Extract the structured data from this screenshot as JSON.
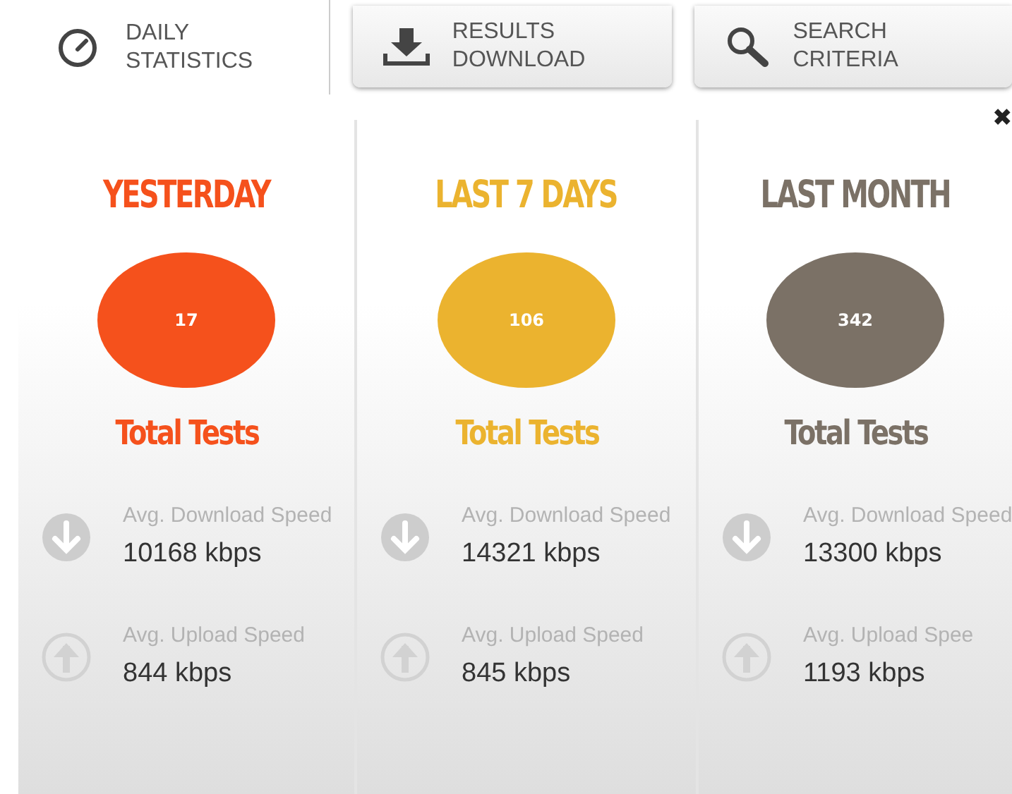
{
  "tabs": [
    {
      "kind": "gauge",
      "label_lines": [
        "DAILY",
        "STATISTICS"
      ],
      "selected": true
    },
    {
      "kind": "download",
      "label_lines": [
        "RESULTS",
        "DOWNLOAD"
      ],
      "selected": false
    },
    {
      "kind": "search",
      "label_lines": [
        "SEARCH",
        "CRITERIA"
      ],
      "selected": false
    }
  ],
  "close": "✖",
  "periods": [
    {
      "title": "YESTERDAY",
      "color": "#f5511c",
      "total": "17",
      "total_label": "Total Tests",
      "download_label": "Avg. Download Speed",
      "download": "10168 kbps",
      "upload_label": "Avg. Upload Speed",
      "upload": "844 kbps"
    },
    {
      "title": "LAST 7 DAYS",
      "color": "#ebb32f",
      "total": "106",
      "total_label": "Total Tests",
      "download_label": "Avg. Download Speed",
      "download": "14321 kbps",
      "upload_label": "Avg. Upload Speed",
      "upload": "845 kbps"
    },
    {
      "title": "LAST MONTH",
      "color": "#7b7166",
      "total": "342",
      "total_label": "Total Tests",
      "download_label": "Avg. Download Speed",
      "download": "13300 kbps",
      "upload_label": "Avg. Upload Spee",
      "upload": "1193 kbps"
    }
  ]
}
